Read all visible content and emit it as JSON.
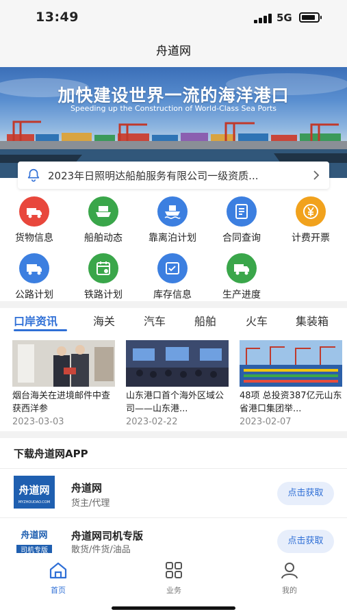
{
  "status_bar": {
    "time": "13:49",
    "network": "5G",
    "battery_level": 0.85
  },
  "header": {
    "title": "舟道网"
  },
  "banner": {
    "title": "加快建设世界一流的海洋港口",
    "subtitle": "Speeding up the Construction of World-Class Sea Ports"
  },
  "notice": {
    "icon": "bell-icon",
    "text": "2023年日照明达船舶服务有限公司一级资质..."
  },
  "quick_menu": [
    {
      "label": "货物信息",
      "icon": "truck-cargo-icon",
      "color": "#e8473c"
    },
    {
      "label": "船舶动态",
      "icon": "ship-icon",
      "color": "#3aa64a"
    },
    {
      "label": "靠离泊计划",
      "icon": "berth-ship-icon",
      "color": "#3c7fe0"
    },
    {
      "label": "合同查询",
      "icon": "contract-icon",
      "color": "#3c7fe0"
    },
    {
      "label": "计费开票",
      "icon": "yen-icon",
      "color": "#f1a21d"
    },
    {
      "label": "公路计划",
      "icon": "road-truck-icon",
      "color": "#3c7fe0"
    },
    {
      "label": "铁路计划",
      "icon": "rail-calendar-icon",
      "color": "#3aa64a"
    },
    {
      "label": "库存信息",
      "icon": "inventory-icon",
      "color": "#3c7fe0"
    },
    {
      "label": "生产进度",
      "icon": "progress-truck-icon",
      "color": "#3aa64a"
    }
  ],
  "news_tabs": [
    "口岸资讯",
    "海关",
    "汽车",
    "船舶",
    "火车",
    "集装箱"
  ],
  "news": [
    {
      "title": "烟台海关在进境邮件中查获西洋参",
      "date": "2023-03-03"
    },
    {
      "title": "山东港口首个海外区域公司——山东港...",
      "date": "2023-02-22"
    },
    {
      "title": "48项 总投资387亿元山东省港口集团举...",
      "date": "2023-02-07"
    }
  ],
  "download": {
    "title": "下载舟道网APP",
    "apps": [
      {
        "name": "舟道网",
        "desc": "货主/代理",
        "button": "点击获取",
        "logo_text": "舟道网",
        "logo_sub": "MYZHOUDAO.COM"
      },
      {
        "name": "舟道网司机专版",
        "desc": "散货/件货/油品",
        "button": "点击获取",
        "logo_text": "舟道网",
        "logo_sub": "司机专版"
      }
    ]
  },
  "bottom_nav": [
    {
      "label": "首页",
      "icon": "home-icon",
      "active": true
    },
    {
      "label": "业务",
      "icon": "grid-icon",
      "active": false
    },
    {
      "label": "我的",
      "icon": "user-icon",
      "active": false
    }
  ],
  "colors": {
    "accent": "#2f6fd6",
    "red": "#e8473c",
    "green": "#3aa64a",
    "blue": "#3c7fe0",
    "orange": "#f1a21d"
  }
}
